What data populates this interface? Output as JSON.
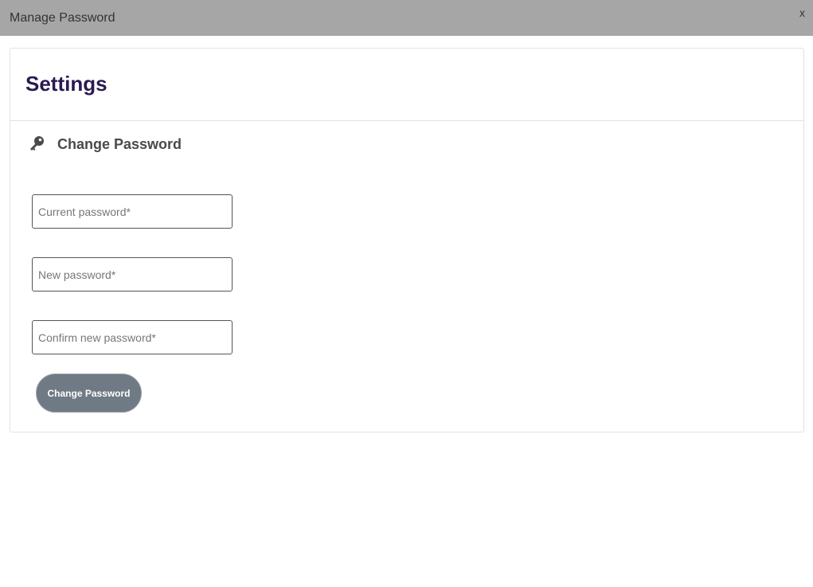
{
  "window": {
    "title": "Manage Password",
    "close_label": "x"
  },
  "settings": {
    "heading": "Settings",
    "section_title": "Change Password",
    "section_icon": "key-icon"
  },
  "form": {
    "current_password": {
      "value": "",
      "placeholder": "Current password*"
    },
    "new_password": {
      "value": "",
      "placeholder": "New password*"
    },
    "confirm_password": {
      "value": "",
      "placeholder": "Confirm new password*"
    },
    "submit_label": "Change Password"
  },
  "colors": {
    "titlebar": "#a6a6a6",
    "heading": "#2a1a52",
    "button": "#707a85"
  }
}
